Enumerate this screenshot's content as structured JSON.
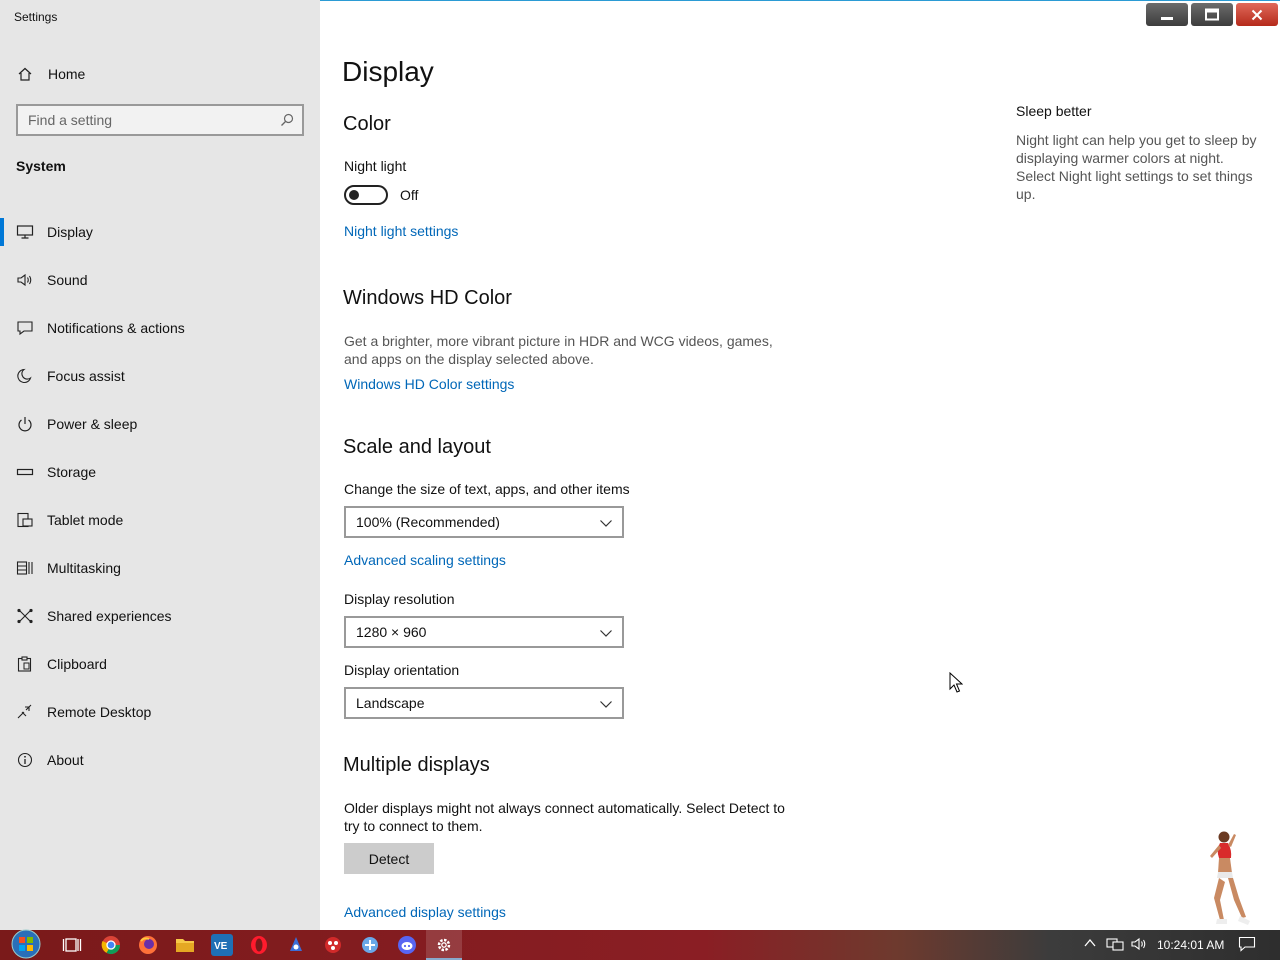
{
  "window": {
    "title": "Settings",
    "controls": [
      "minimize",
      "maximize",
      "close"
    ]
  },
  "sidebar": {
    "home_label": "Home",
    "search_placeholder": "Find a setting",
    "section": "System",
    "items": [
      {
        "label": "Display",
        "icon": "monitor-icon",
        "active": true
      },
      {
        "label": "Sound",
        "icon": "speaker-icon"
      },
      {
        "label": "Notifications & actions",
        "icon": "notification-icon"
      },
      {
        "label": "Focus assist",
        "icon": "moon-icon"
      },
      {
        "label": "Power & sleep",
        "icon": "power-icon"
      },
      {
        "label": "Storage",
        "icon": "storage-icon"
      },
      {
        "label": "Tablet mode",
        "icon": "tablet-icon"
      },
      {
        "label": "Multitasking",
        "icon": "multitasking-icon"
      },
      {
        "label": "Shared experiences",
        "icon": "shared-icon"
      },
      {
        "label": "Clipboard",
        "icon": "clipboard-icon"
      },
      {
        "label": "Remote Desktop",
        "icon": "remote-desktop-icon"
      },
      {
        "label": "About",
        "icon": "info-icon"
      }
    ]
  },
  "main": {
    "title": "Display",
    "color": {
      "heading": "Color",
      "night_light_label": "Night light",
      "night_light_state": "Off",
      "night_light_link": "Night light settings"
    },
    "hdr": {
      "heading": "Windows HD Color",
      "description": "Get a brighter, more vibrant picture in HDR and WCG videos, games, and apps on the display selected above.",
      "link": "Windows HD Color settings"
    },
    "scale": {
      "heading": "Scale and layout",
      "size_label": "Change the size of text, apps, and other items",
      "size_value": "100% (Recommended)",
      "advanced_link": "Advanced scaling settings",
      "resolution_label": "Display resolution",
      "resolution_value": "1280 × 960",
      "orientation_label": "Display orientation",
      "orientation_value": "Landscape"
    },
    "multiple": {
      "heading": "Multiple displays",
      "description": "Older displays might not always connect automatically. Select Detect to try to connect to them.",
      "detect_button": "Detect",
      "advanced_link": "Advanced display settings"
    }
  },
  "aside": {
    "heading": "Sleep better",
    "text": "Night light can help you get to sleep by displaying warmer colors at night. Select Night light settings to set things up."
  },
  "taskbar": {
    "apps": [
      "start-orb",
      "task-view-icon",
      "chrome-icon",
      "firefox-icon",
      "file-explorer-icon",
      "vs-code-icon",
      "opera-icon",
      "app-icon",
      "app-icon",
      "app-icon",
      "discord-icon",
      "settings-icon"
    ],
    "clock": "10:24:01 AM"
  },
  "colors": {
    "accent": "#0078d7",
    "link": "#0067b8",
    "sidebar_bg": "#e6e6e6",
    "taskbar": "#7a1a1a"
  }
}
